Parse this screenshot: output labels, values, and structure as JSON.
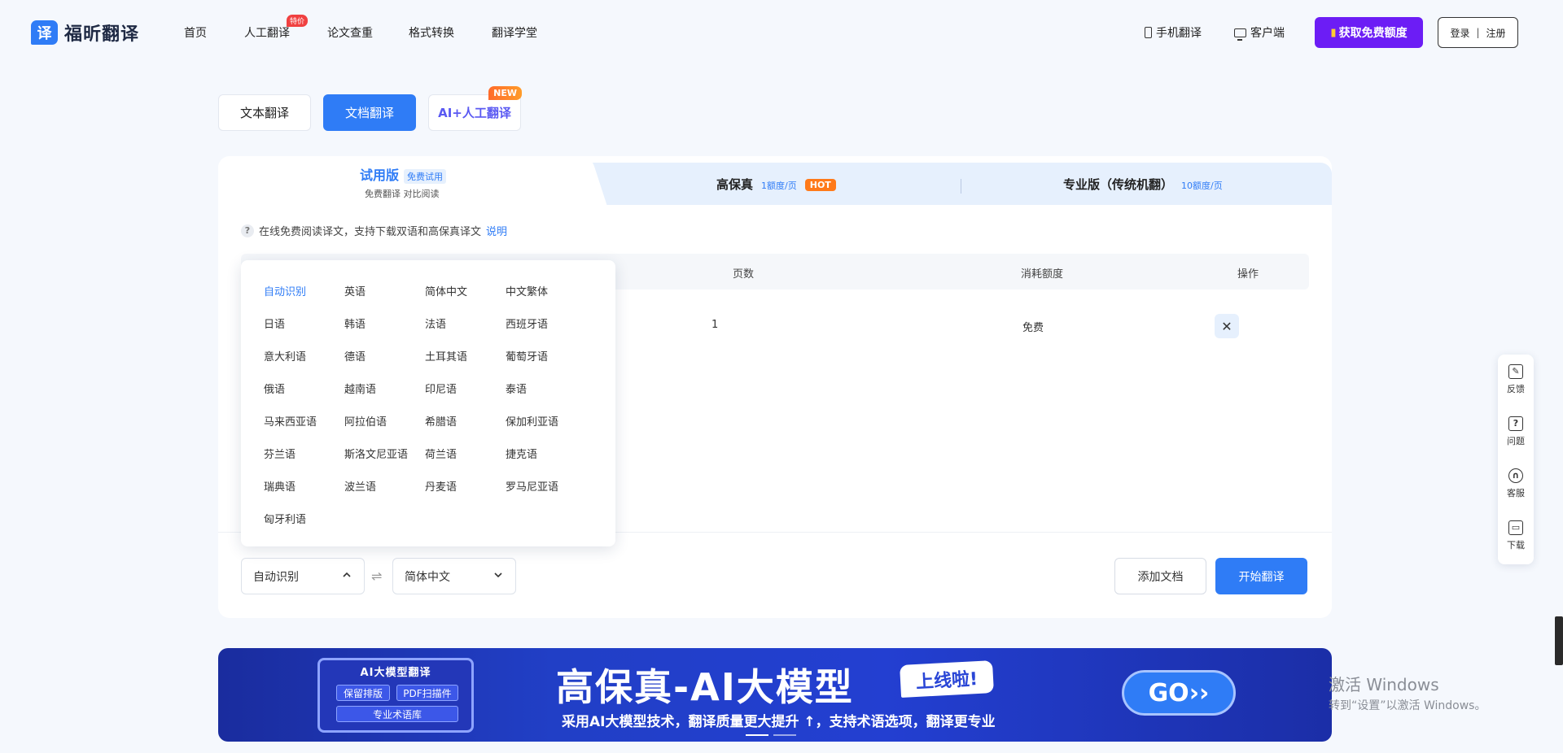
{
  "brand": {
    "logo_char": "译",
    "name": "福昕翻译"
  },
  "nav": {
    "items": [
      "首页",
      "人工翻译",
      "论文查重",
      "格式转换",
      "翻译学堂"
    ],
    "badge": "特价"
  },
  "header": {
    "mobile": "手机翻译",
    "desktop": "客户端",
    "free_button": "获取免费额度",
    "login": "登录",
    "register": "注册"
  },
  "mode_tabs": {
    "text": "文本翻译",
    "doc": "文档翻译",
    "ai_prefix": "AI+",
    "ai_rest": "人工翻译",
    "new_badge": "NEW"
  },
  "version_tabs": {
    "trial": {
      "title": "试用版",
      "tag": "免费试用",
      "sub": "免费翻译 对比阅读"
    },
    "hifi": {
      "title": "高保真",
      "price": "1额度/页",
      "badge": "HOT"
    },
    "pro": {
      "title": "专业版（传统机翻）",
      "price": "10额度/页"
    }
  },
  "info": {
    "text": "在线免费阅读译文，支持下载双语和高保真译文",
    "link": "说明"
  },
  "table": {
    "headers": {
      "pages": "页数",
      "cost": "消耗额度",
      "action": "操作"
    },
    "row": {
      "pages": "1",
      "cost": "免费"
    }
  },
  "languages": [
    "自动识别",
    "英语",
    "简体中文",
    "中文繁体",
    "日语",
    "韩语",
    "法语",
    "西班牙语",
    "意大利语",
    "德语",
    "土耳其语",
    "葡萄牙语",
    "俄语",
    "越南语",
    "印尼语",
    "泰语",
    "马来西亚语",
    "阿拉伯语",
    "希腊语",
    "保加利亚语",
    "芬兰语",
    "斯洛文尼亚语",
    "荷兰语",
    "捷克语",
    "瑞典语",
    "波兰语",
    "丹麦语",
    "罗马尼亚语",
    "匈牙利语"
  ],
  "controls": {
    "source_lang": "自动识别",
    "target_lang": "简体中文",
    "add_doc": "添加文档",
    "start": "开始翻译"
  },
  "banner": {
    "chip_title": "AI大模型翻译",
    "chip_pills": [
      "保留排版",
      "PDF扫描件",
      "专业术语库"
    ],
    "title": "高保真-AI大模型",
    "live": "上线啦!",
    "subtitle": "采用AI大模型技术，翻译质量更大提升 ↑，支持术语选项，翻译更专业",
    "go": "GO››"
  },
  "side": {
    "feedback": "反馈",
    "question": "问题",
    "service": "客服",
    "download": "下载"
  },
  "watermark": {
    "line1": "激活 Windows",
    "line2": "转到“设置”以激活 Windows。"
  },
  "colors": {
    "primary": "#2f7cf6",
    "purple": "#6c1df5",
    "hot": "#ff7a1a",
    "badge_red": "#f04141"
  }
}
